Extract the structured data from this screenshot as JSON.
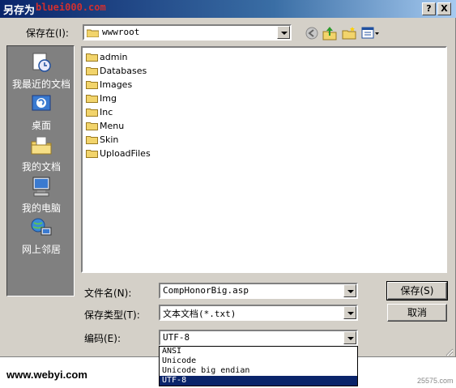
{
  "title": "另存为",
  "watermark_top": "bluei000.com",
  "titlebar_buttons": {
    "help": "?",
    "close": "X"
  },
  "save_in": {
    "label": "保存在(I):",
    "value": "wwwroot"
  },
  "toolbar_icons": [
    "back-icon",
    "up-folder-icon",
    "new-folder-icon",
    "view-menu-icon"
  ],
  "places": [
    {
      "label": "我最近的文档",
      "icon": "recent-documents-icon"
    },
    {
      "label": "桌面",
      "icon": "desktop-icon"
    },
    {
      "label": "我的文档",
      "icon": "my-documents-icon"
    },
    {
      "label": "我的电脑",
      "icon": "my-computer-icon"
    },
    {
      "label": "网上邻居",
      "icon": "network-places-icon"
    }
  ],
  "files": [
    "admin",
    "Databases",
    "Images",
    "Img",
    "Inc",
    "Menu",
    "Skin",
    "UploadFiles"
  ],
  "filename": {
    "label": "文件名(N):",
    "value": "CompHonorBig.asp"
  },
  "filetype": {
    "label": "保存类型(T):",
    "value": "文本文档(*.txt)"
  },
  "encoding": {
    "label": "编码(E):",
    "value": "UTF-8",
    "options": [
      "ANSI",
      "Unicode",
      "Unicode big endian",
      "UTF-8"
    ],
    "selected_index": 3
  },
  "buttons": {
    "save": "保存(S)",
    "cancel": "取消"
  },
  "footer": {
    "left": "www.webyi.com",
    "right": "25575.com"
  },
  "colors": {
    "title_start": "#0a246a",
    "title_end": "#a6caf0",
    "face": "#d4d0c8",
    "places_bg": "#808080",
    "selection": "#0a246a",
    "folder": "#f2d46b"
  }
}
